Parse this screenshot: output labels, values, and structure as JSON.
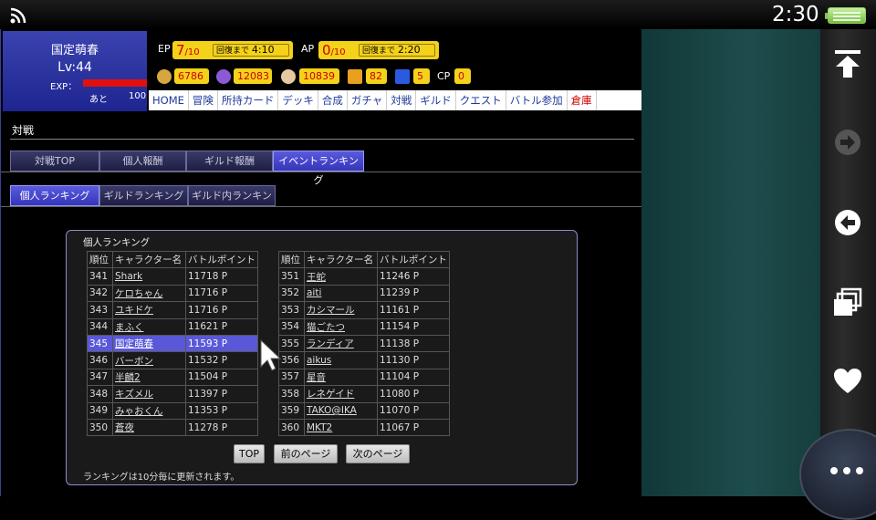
{
  "status": {
    "time": "2:30"
  },
  "profile": {
    "name": "国定萌春",
    "level": "Lv:44",
    "exp_label": "EXP：",
    "next_label": "あと",
    "next_value": "100"
  },
  "ep": {
    "label": "EP",
    "current": "7",
    "max": "/10",
    "recover_label": "回復まで",
    "recover_time": "4:10"
  },
  "ap": {
    "label": "AP",
    "current": "0",
    "max": "/10",
    "recover_label": "回復まで",
    "recover_time": "2:20"
  },
  "currencies": [
    {
      "icon": "money-bag-icon",
      "value": "6786"
    },
    {
      "icon": "cat-face-icon",
      "value": "12083"
    },
    {
      "icon": "character-face-icon",
      "value": "10839"
    },
    {
      "icon": "gp-icon",
      "value": "82"
    },
    {
      "icon": "fh-icon",
      "value": "5"
    }
  ],
  "cp": {
    "label": "CP",
    "value": "0"
  },
  "nav": [
    "HOME",
    "冒険",
    "所持カード",
    "デッキ",
    "合成",
    "ガチャ",
    "対戦",
    "ギルド",
    "クエスト",
    "バトル参加",
    "倉庫"
  ],
  "page_title": "対戦",
  "tabs": [
    "対戦TOP",
    "個人報酬",
    "ギルド報酬",
    "イベントランキング"
  ],
  "subtabs": [
    "個人ランキング",
    "ギルドランキング",
    "ギルド内ランキン"
  ],
  "ranking": {
    "title": "個人ランキング",
    "headers": [
      "順位",
      "キャラクター名",
      "バトルポイント"
    ],
    "left": [
      [
        "341",
        "Shark",
        "11718 P"
      ],
      [
        "342",
        "ケロちゃん",
        "11716 P"
      ],
      [
        "343",
        "ユキドケ",
        "11716 P"
      ],
      [
        "344",
        "まふく",
        "11621 P"
      ],
      [
        "345",
        "国定萌春",
        "11593 P"
      ],
      [
        "346",
        "バーボン",
        "11532 P"
      ],
      [
        "347",
        "半麟2",
        "11504 P"
      ],
      [
        "348",
        "キズメル",
        "11397 P"
      ],
      [
        "349",
        "みゃおくん",
        "11353 P"
      ],
      [
        "350",
        "蒼夜",
        "11278 P"
      ]
    ],
    "right": [
      [
        "351",
        "王蛇",
        "11246 P"
      ],
      [
        "352",
        "aiti",
        "11239 P"
      ],
      [
        "353",
        "カシマール",
        "11161 P"
      ],
      [
        "354",
        "猫ごたつ",
        "11154 P"
      ],
      [
        "355",
        "ランディア",
        "11138 P"
      ],
      [
        "356",
        "aikus",
        "11130 P"
      ],
      [
        "357",
        "星音",
        "11104 P"
      ],
      [
        "358",
        "レネゲイド",
        "11080 P"
      ],
      [
        "359",
        "TAKO@IKA",
        "11070 P"
      ],
      [
        "360",
        "MKT2",
        "11067 P"
      ]
    ],
    "buttons": {
      "top": "TOP",
      "prev": "前のページ",
      "next": "次のページ"
    },
    "note": "ランキングは10分毎に更新されます。"
  },
  "colors": {
    "accent_blue": "#3535b8",
    "pill_yellow": "#f4d21a",
    "highlight": "#5a58d8"
  }
}
